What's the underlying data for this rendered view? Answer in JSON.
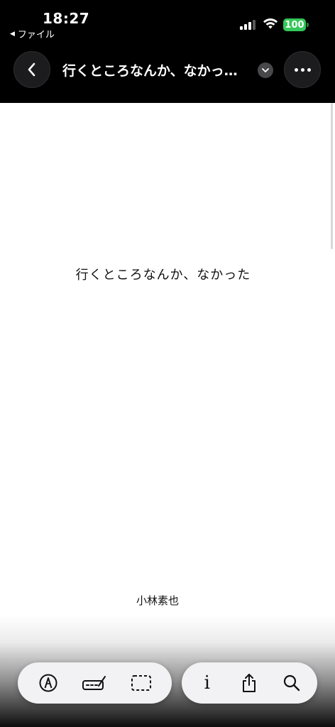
{
  "status_bar": {
    "time": "18:27",
    "back_app_arrow": "◀",
    "back_app_label": "ファイル",
    "battery": "100",
    "icons": [
      "cellular-signal-icon",
      "wifi-icon",
      "battery-icon"
    ],
    "battery_color": "#34c759"
  },
  "nav": {
    "title": "行くところなんか、なかっ…",
    "icons": [
      "chevron-left-icon",
      "chevron-down-icon",
      "ellipsis-icon"
    ]
  },
  "document": {
    "heading": "行くところなんか、なかった",
    "author": "小林素也"
  },
  "toolbar_left": {
    "icons": [
      "markup-pen-icon",
      "signature-icon",
      "dashed-selection-icon"
    ]
  },
  "toolbar_right": {
    "icons": [
      "info-icon",
      "share-icon",
      "search-icon"
    ],
    "info_glyph": "i"
  }
}
